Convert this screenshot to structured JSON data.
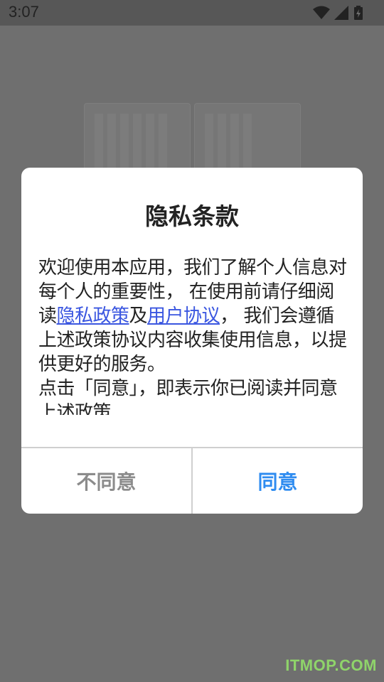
{
  "status_bar": {
    "time": "3:07",
    "icons": [
      "wifi-icon",
      "signal-icon",
      "battery-icon"
    ]
  },
  "dialog": {
    "title": "隐私条款",
    "body": {
      "text_1": "欢迎使用本应用，我们了解个人信息对每个人的重要性，  在使用前请仔细阅读",
      "link_privacy": "隐私政策",
      "text_2": "及",
      "link_agreement": "用户协议",
      "text_3": "，  我们会遵循上述政策协议内容收集使用信息，以提供更好的服务。",
      "text_4": "点击「同意」，即表示你已阅读并同意上述政策"
    },
    "buttons": {
      "disagree": "不同意",
      "agree": "同意"
    }
  },
  "watermark": "ITMOP.COM",
  "colors": {
    "link": "#3a56e0",
    "agree": "#2f8cf0",
    "disagree": "#8c8c8c",
    "overlay": "#6e6e6e"
  }
}
